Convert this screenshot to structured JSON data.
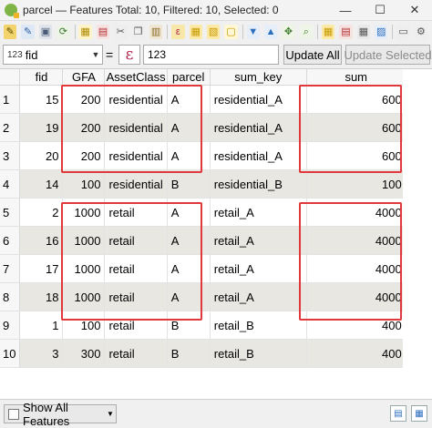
{
  "window": {
    "title": "parcel — Features Total: 10, Filtered: 10, Selected: 0",
    "minimize": "—",
    "maximize": "☐",
    "close": "✕"
  },
  "toolbar": {
    "icons": [
      {
        "name": "toggle-editing-icon",
        "glyph": "✎",
        "bg": "#f3d36b",
        "fg": "#5a4a00"
      },
      {
        "name": "multi-edit-icon",
        "glyph": "✎",
        "bg": "#dfe8f5",
        "fg": "#2a5fa0"
      },
      {
        "name": "save-edits-icon",
        "glyph": "▣",
        "bg": "#dfe3ea",
        "fg": "#4a5a78"
      },
      {
        "name": "reload-icon",
        "glyph": "⟳",
        "bg": "#eef3e8",
        "fg": "#3a7a2a"
      },
      {
        "name": "add-feature-icon",
        "glyph": "▦",
        "bg": "#fff3c9",
        "fg": "#b08a00"
      },
      {
        "name": "delete-feature-icon",
        "glyph": "▤",
        "bg": "#f7e2e2",
        "fg": "#b32d2d"
      },
      {
        "name": "cut-icon",
        "glyph": "✂",
        "bg": "#eeeeee",
        "fg": "#555555"
      },
      {
        "name": "copy-icon",
        "glyph": "❐",
        "bg": "#eeeeee",
        "fg": "#555555"
      },
      {
        "name": "paste-icon",
        "glyph": "▥",
        "bg": "#efe6d3",
        "fg": "#8a6a2a"
      },
      {
        "name": "select-expression-icon",
        "glyph": "ε",
        "bg": "#f7e7a8",
        "fg": "#b5284f"
      },
      {
        "name": "select-all-icon",
        "glyph": "▦",
        "bg": "#fde9a6",
        "fg": "#c79a00"
      },
      {
        "name": "invert-selection-icon",
        "glyph": "▧",
        "bg": "#fde9a6",
        "fg": "#c79a00"
      },
      {
        "name": "deselect-icon",
        "glyph": "▢",
        "bg": "#fff7d6",
        "fg": "#c79a00"
      },
      {
        "name": "filter-icon",
        "glyph": "▼",
        "bg": "#e6eef9",
        "fg": "#2a6ebd"
      },
      {
        "name": "move-selection-top-icon",
        "glyph": "▲",
        "bg": "#e6eef9",
        "fg": "#2a6ebd"
      },
      {
        "name": "pan-to-selected-icon",
        "glyph": "✥",
        "bg": "#eef5e6",
        "fg": "#3a7a2a"
      },
      {
        "name": "zoom-to-selected-icon",
        "glyph": "⌕",
        "bg": "#eef5e6",
        "fg": "#3a7a2a"
      },
      {
        "name": "new-field-icon",
        "glyph": "▦",
        "bg": "#fde9a6",
        "fg": "#c79a00"
      },
      {
        "name": "delete-field-icon",
        "glyph": "▤",
        "bg": "#f7e2e2",
        "fg": "#b32d2d"
      },
      {
        "name": "field-calculator-icon",
        "glyph": "▦",
        "bg": "#e9e9e9",
        "fg": "#555555"
      },
      {
        "name": "conditional-formatting-icon",
        "glyph": "▨",
        "bg": "#e6eef9",
        "fg": "#2a6ebd"
      },
      {
        "name": "dock-icon",
        "glyph": "▭",
        "bg": "#eeeeee",
        "fg": "#555555"
      },
      {
        "name": "actions-icon",
        "glyph": "⚙",
        "bg": "#eeeeee",
        "fg": "#555555"
      }
    ]
  },
  "expression": {
    "field_type_symbol": "123",
    "field_name": "fid",
    "equals": "=",
    "epsilon": "ε",
    "value_prefix": "123",
    "update_all": "Update All",
    "update_selected": "Update Selected"
  },
  "table": {
    "columns": [
      "fid",
      "GFA",
      "AssetClass",
      "parcel",
      "sum_key",
      "sum"
    ],
    "rows": [
      {
        "row": "1",
        "fid": "15",
        "GFA": "200",
        "AssetClass": "residential",
        "parcel": "A",
        "sum_key": "residential_A",
        "sum": "600"
      },
      {
        "row": "2",
        "fid": "19",
        "GFA": "200",
        "AssetClass": "residential",
        "parcel": "A",
        "sum_key": "residential_A",
        "sum": "600"
      },
      {
        "row": "3",
        "fid": "20",
        "GFA": "200",
        "AssetClass": "residential",
        "parcel": "A",
        "sum_key": "residential_A",
        "sum": "600"
      },
      {
        "row": "4",
        "fid": "14",
        "GFA": "100",
        "AssetClass": "residential",
        "parcel": "B",
        "sum_key": "residential_B",
        "sum": "100"
      },
      {
        "row": "5",
        "fid": "2",
        "GFA": "1000",
        "AssetClass": "retail",
        "parcel": "A",
        "sum_key": "retail_A",
        "sum": "4000"
      },
      {
        "row": "6",
        "fid": "16",
        "GFA": "1000",
        "AssetClass": "retail",
        "parcel": "A",
        "sum_key": "retail_A",
        "sum": "4000"
      },
      {
        "row": "7",
        "fid": "17",
        "GFA": "1000",
        "AssetClass": "retail",
        "parcel": "A",
        "sum_key": "retail_A",
        "sum": "4000"
      },
      {
        "row": "8",
        "fid": "18",
        "GFA": "1000",
        "AssetClass": "retail",
        "parcel": "A",
        "sum_key": "retail_A",
        "sum": "4000"
      },
      {
        "row": "9",
        "fid": "1",
        "GFA": "100",
        "AssetClass": "retail",
        "parcel": "B",
        "sum_key": "retail_B",
        "sum": "400"
      },
      {
        "row": "10",
        "fid": "3",
        "GFA": "300",
        "AssetClass": "retail",
        "parcel": "B",
        "sum_key": "retail_B",
        "sum": "400"
      }
    ]
  },
  "highlight_color": "#e0383b",
  "bottom": {
    "show_all": "Show All Features"
  }
}
